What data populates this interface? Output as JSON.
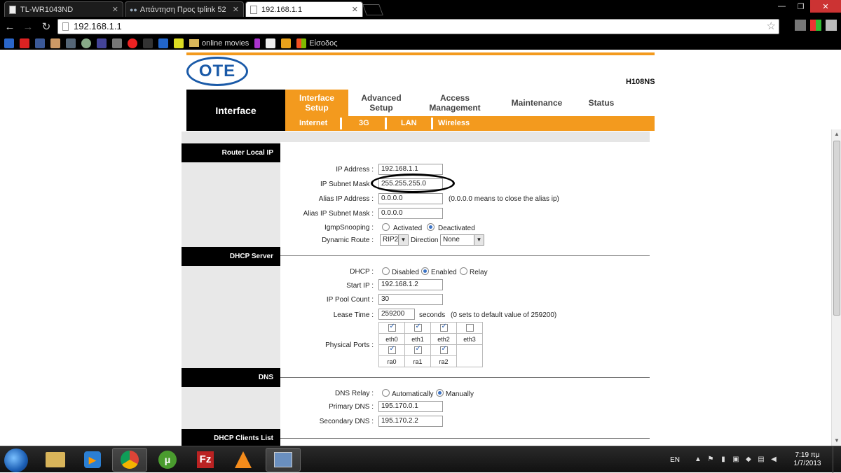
{
  "browser": {
    "tabs": [
      {
        "title": "TL-WR1043ND",
        "active": false
      },
      {
        "title": "Απάντηση Προς tplink 52",
        "active": false
      },
      {
        "title": "192.168.1.1",
        "active": true
      }
    ],
    "url": "192.168.1.1",
    "bookmarks": {
      "online_movies": "online movies",
      "eisodos": "Είσοδος"
    }
  },
  "router": {
    "brand": "OTE",
    "model": "H108NS",
    "nav": {
      "current_section": "Interface",
      "selected_item": "Interface Setup",
      "items": [
        "Advanced Setup",
        "Access Management",
        "Maintenance",
        "Status"
      ],
      "subitems": [
        "Internet",
        "3G",
        "LAN",
        "Wireless"
      ]
    },
    "router_local_ip": {
      "header": "Router Local IP",
      "ip_address_label": "IP Address :",
      "ip_address": "192.168.1.1",
      "subnet_label": "IP Subnet Mask :",
      "subnet": "255.255.255.0",
      "alias_ip_label": "Alias IP Address :",
      "alias_ip": "0.0.0.0",
      "alias_note": "(0.0.0.0 means to close the alias ip)",
      "alias_subnet_label": "Alias IP Subnet Mask :",
      "alias_subnet": "0.0.0.0",
      "igmp_label": "IgmpSnooping :",
      "igmp_options": [
        "Activated",
        "Deactivated"
      ],
      "igmp_selected": "Deactivated",
      "dynamic_route_label": "Dynamic Route :",
      "dynamic_route": "RIP2",
      "direction_label": "Direction",
      "direction": "None"
    },
    "dhcp_server": {
      "header": "DHCP Server",
      "dhcp_label": "DHCP :",
      "dhcp_options": [
        "Disabled",
        "Enabled",
        "Relay"
      ],
      "dhcp_selected": "Enabled",
      "start_ip_label": "Start IP :",
      "start_ip": "192.168.1.2",
      "pool_count_label": "IP Pool Count :",
      "pool_count": "30",
      "lease_label": "Lease Time :",
      "lease_time": "259200",
      "lease_unit": "seconds",
      "lease_note": "(0 sets to default value of 259200)",
      "ports_label": "Physical Ports :",
      "ports": [
        {
          "name": "eth0",
          "checked": true
        },
        {
          "name": "eth1",
          "checked": true
        },
        {
          "name": "eth2",
          "checked": true
        },
        {
          "name": "eth3",
          "checked": false
        },
        {
          "name": "ra0",
          "checked": true
        },
        {
          "name": "ra1",
          "checked": true
        },
        {
          "name": "ra2",
          "checked": true
        }
      ]
    },
    "dns": {
      "header": "DNS",
      "relay_label": "DNS Relay :",
      "relay_options": [
        "Automatically",
        "Manually"
      ],
      "relay_selected": "Manually",
      "primary_label": "Primary DNS :",
      "primary": "195.170.0.1",
      "secondary_label": "Secondary DNS :",
      "secondary": "195.170.2.2"
    },
    "dhcp_clients": {
      "header": "DHCP Clients List"
    }
  },
  "taskbar": {
    "language": "EN",
    "time": "7:19 πμ",
    "date": "1/7/2013"
  }
}
